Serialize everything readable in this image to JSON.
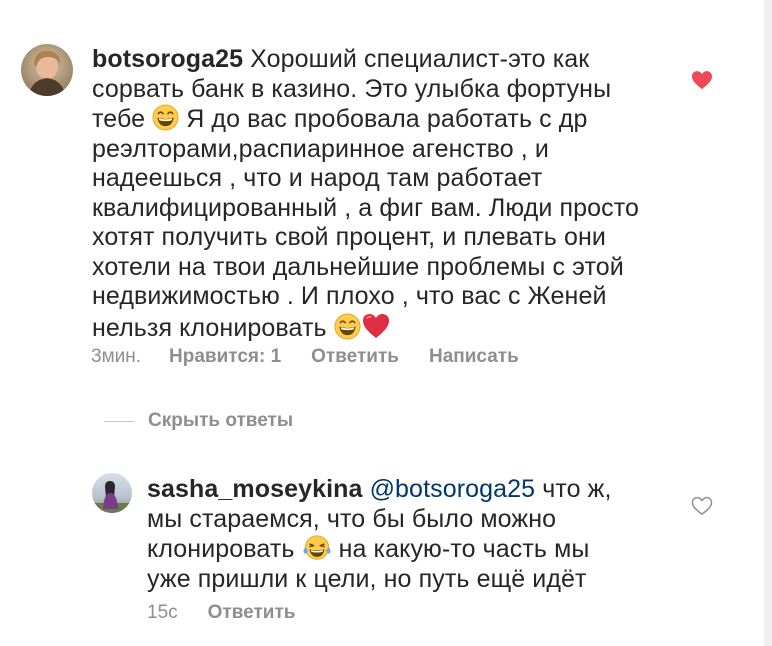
{
  "comment": {
    "username": "botsoroga25",
    "lines": [
      " Хороший специалист-это как",
      "сорвать банк в казино. Это улыбка фортуны",
      "тебе",
      " Я до вас пробовала работать с др",
      "реэлторами,распиаринное агенство , и",
      "надеешься , что и народ там работает",
      "квалифицированный , а фиг вам. Люди просто",
      "хотят получить свой процент, и плевать они",
      "хотели на твои дальнейшие проблемы с этой",
      "недвижимостью . И плохо , что вас с Женей",
      "нельзя клонировать"
    ],
    "time": "3мин.",
    "likes": "Нравится: 1",
    "reply": "Ответить",
    "message": "Написать",
    "liked": true,
    "emojis": [
      "grinning-face-with-smiling-eyes",
      "red-heart"
    ]
  },
  "hide_replies": "Скрыть ответы",
  "reply": {
    "username": "sasha_moseykina",
    "mention": "@botsoroga25",
    "lines": [
      " что ж,",
      "мы стараемся, что бы было можно",
      "клонировать",
      " на какую-то часть мы",
      "уже пришли к цели, но путь ещё идёт"
    ],
    "time": "15с",
    "reply": "Ответить",
    "liked": false,
    "emojis": [
      "face-with-tears-of-joy"
    ]
  },
  "colors": {
    "text": "#262626",
    "meta": "#8e8e8e",
    "mention": "#00376b",
    "like": "#ed4956"
  }
}
